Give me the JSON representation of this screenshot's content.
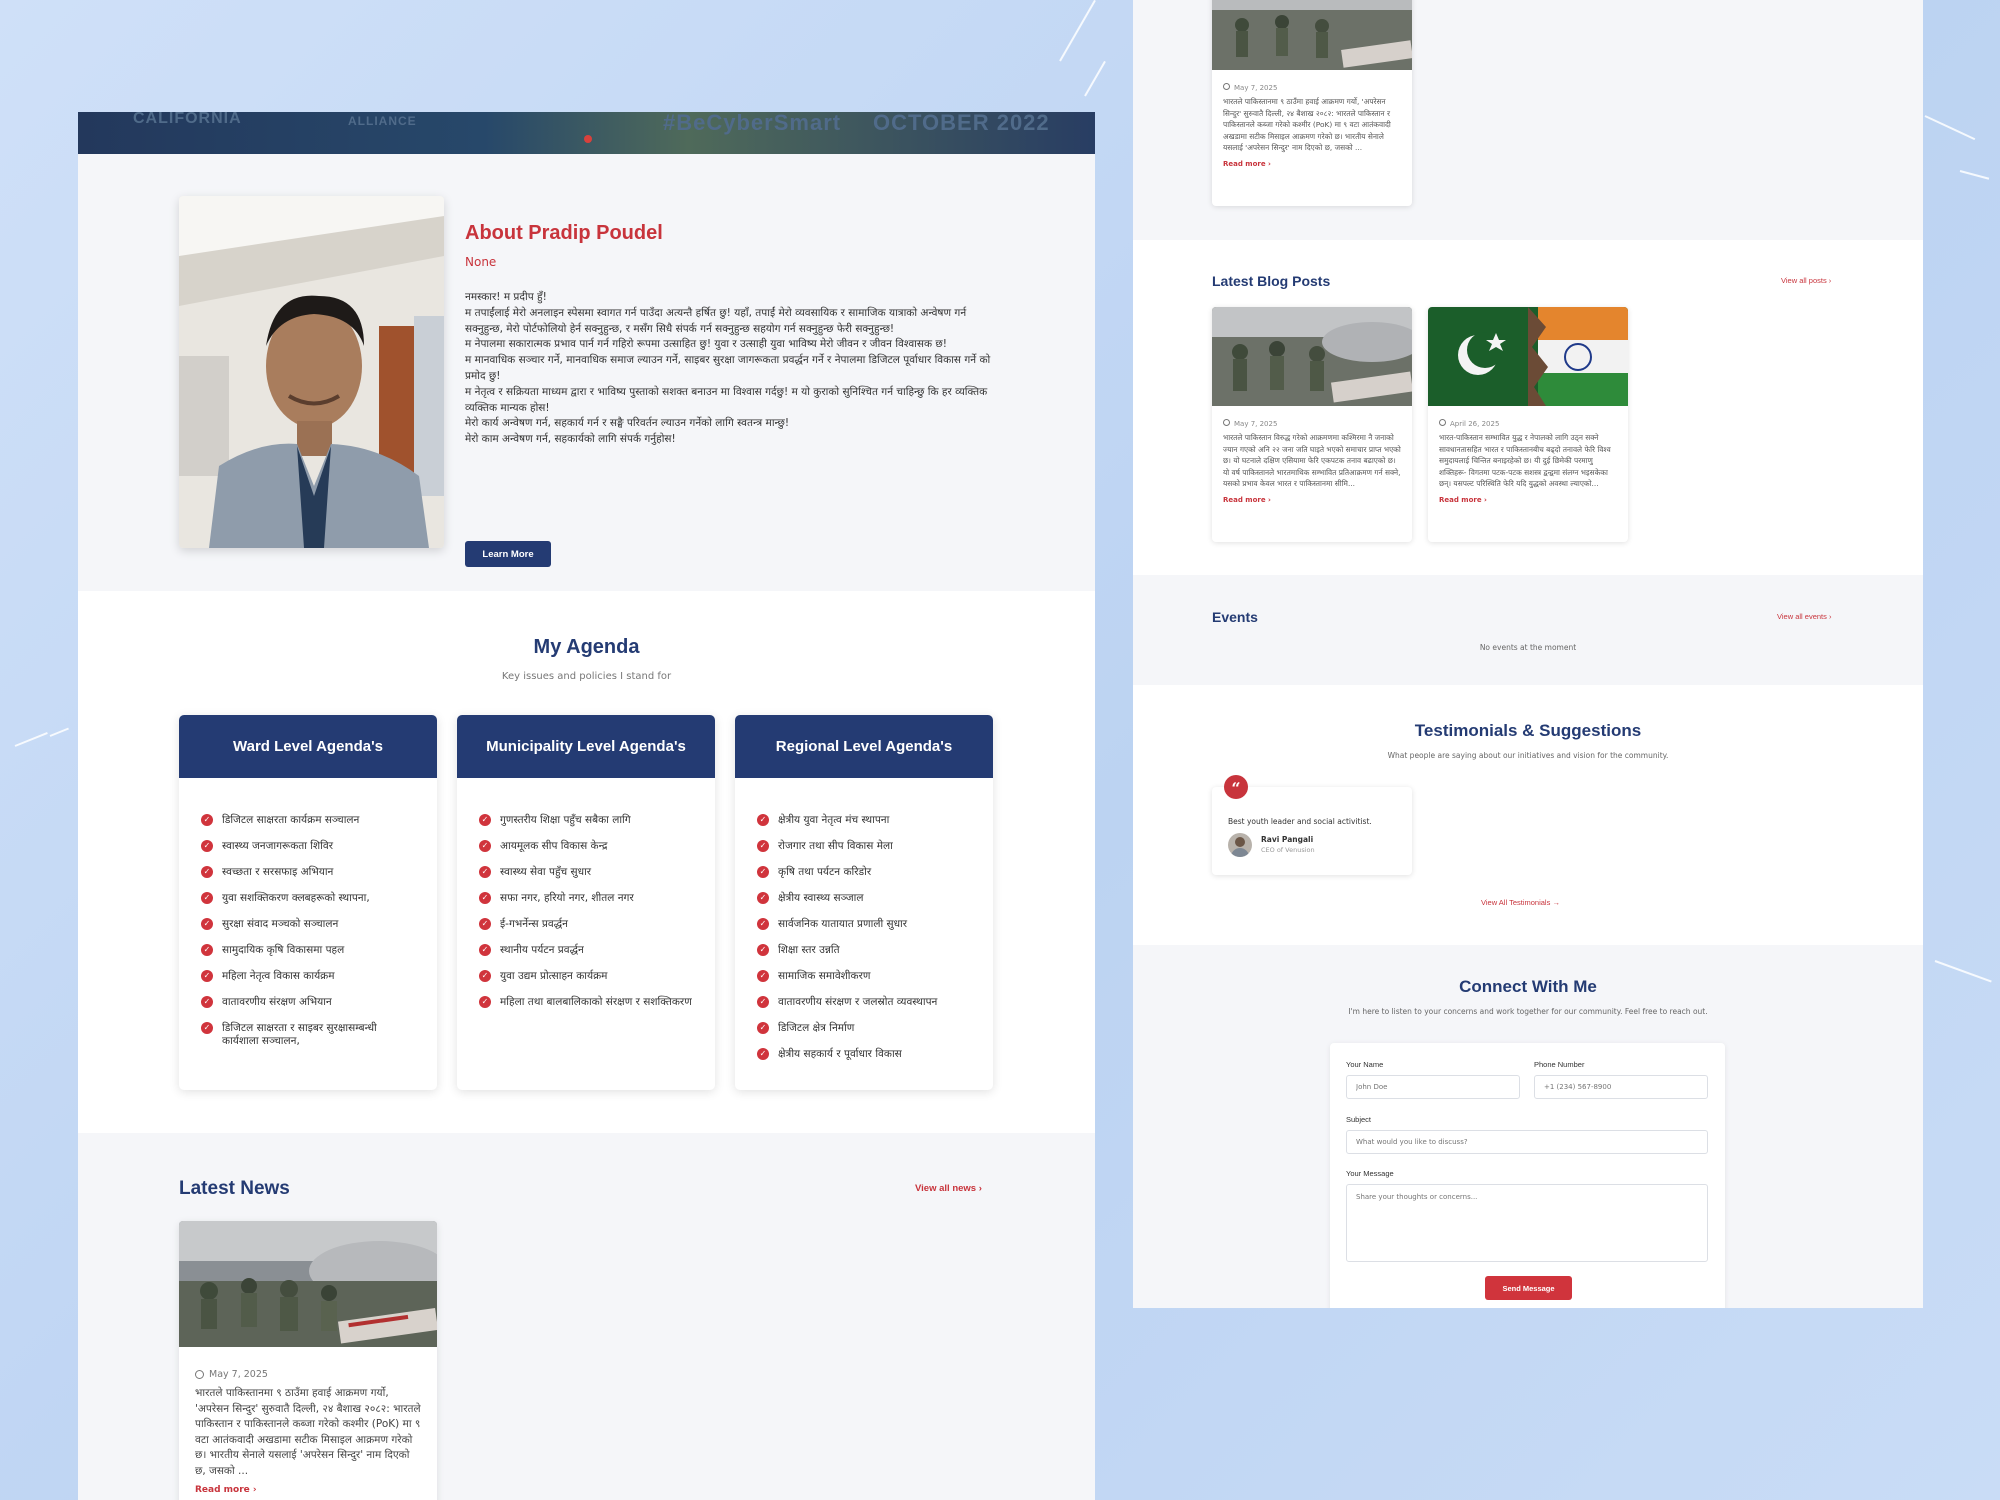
{
  "colors": {
    "primary": "#243b73",
    "accent": "#c8343c",
    "background": "#c5d9f4"
  },
  "hero": {
    "texts": [
      "CALIFORNIA",
      "ALLIANCE",
      "#BeCyberSmart",
      "OCTOBER 2022"
    ]
  },
  "about": {
    "title": "About Pradip Poudel",
    "subtitle": "None",
    "paragraphs": [
      "नमस्कार! म प्रदीप हुँ!",
      "म तपाईंलाई मेरो अनलाइन स्पेसमा स्वागत गर्न पाउँदा अत्यन्तै हर्षित छु! यहाँ, तपाईं मेरो व्यवसायिक र सामाजिक यात्राको अन्वेषण गर्न सक्नुहुन्छ, मेरो पोर्टफोलियो हेर्न सक्नुहुन्छ, र मसँग सिधै संपर्क गर्न सक्नुहुन्छ सहयोग गर्न सक्नुहुन्छ फेरी सक्नुहुन्छ!",
      "म नेपालमा सकारात्मक प्रभाव पार्न गर्न गहिरो रूपमा उत्साहित छु! युवा र उत्साही युवा भाविष्य मेरो जीवन र जीवन विश्वासक छ!",
      "म मानवाधिक सञ्चार गर्ने, मानवाधिक समाज ल्याउन गर्ने, साइबर सुरक्षा जागरूकता प्रवर्द्धन गर्ने र नेपालमा डिजिटल पूर्वाधार विकास गर्ने को प्रमोद छु!",
      "म नेतृत्व र सक्रियता माध्यम द्वारा र भाविष्य पुस्ताको सशक्त बनाउन मा विश्वास गर्दछु! म यो कुराको सुनिश्चित गर्न चाहिन्छु कि हर व्यक्तिक व्यक्तिक मान्यक होस!",
      "मेरो कार्य अन्वेषण गर्न, सहकार्य गर्न र सङ्घै परिवर्तन ल्याउन गर्नेको लागि स्वतन्त्र मान्छु!",
      "मेरो काम अन्वेषण गर्न, सहकार्यको लागि संपर्क गर्नुहोस!"
    ],
    "button_label": "Learn More"
  },
  "agenda": {
    "title": "My Agenda",
    "subtitle": "Key issues and policies I stand for",
    "cards": [
      {
        "title": "Ward Level Agenda's",
        "items": [
          "डिजिटल साक्षरता कार्यक्रम सञ्चालन",
          "स्वास्थ्य जनजागरूकता शिविर",
          "स्वच्छता र सरसफाइ अभियान",
          "युवा सशक्तिकरण क्लबहरूको स्थापना,",
          "सुरक्षा संवाद मञ्चको सञ्चालन",
          "सामुदायिक कृषि विकासमा पहल",
          "महिला नेतृत्व विकास कार्यक्रम",
          "वातावरणीय संरक्षण अभियान",
          "डिजिटल साक्षरता र साइबर सुरक्षासम्बन्धी कार्यशाला सञ्चालन,"
        ]
      },
      {
        "title": "Municipality Level Agenda's",
        "items": [
          "गुणस्तरीय शिक्षा पहुँच सबैका लागि",
          "आयमूलक सीप विकास केन्द्र",
          "स्वास्थ्य सेवा पहुँच सुधार",
          "सफा नगर, हरियो नगर, शीतल नगर",
          "ई-गभर्नेन्स प्रवर्द्धन",
          "स्थानीय पर्यटन प्रवर्द्धन",
          "युवा उद्यम प्रोत्साहन कार्यक्रम",
          "महिला तथा बालबालिकाको संरक्षण र सशक्तिकरण"
        ]
      },
      {
        "title": "Regional Level Agenda's",
        "items": [
          "क्षेत्रीय युवा नेतृत्व मंच स्थापना",
          "रोजगार तथा सीप विकास मेला",
          "कृषि तथा पर्यटन करिडोर",
          "क्षेत्रीय स्वास्थ्य सञ्जाल",
          "सार्वजनिक यातायात प्रणाली सुधार",
          "शिक्षा स्तर उन्नति",
          "सामाजिक समावेशीकरण",
          "वातावरणीय संरक्षण र जलस्रोत व्यवस्थापन",
          "डिजिटल क्षेत्र निर्माण",
          "क्षेत्रीय सहकार्य र पूर्वाधार विकास"
        ]
      }
    ]
  },
  "news": {
    "title": "Latest News",
    "view_all": "View all news",
    "card": {
      "date": "May 7, 2025",
      "excerpt": "भारतले पाकिस्तानमा ९ ठाउँमा हवाई आक्रमण गर्यो, 'अपरेसन सिन्दुर' सुरुवातै दिल्ली, २४ बैशाख २०८२: भारतले पाकिस्तान र पाकिस्तानले कब्जा गरेको कश्मीर (PoK) मा ९ वटा आतंकवादी अखडामा सटीक मिसाइल आक्रमण गरेको छ। भारतीय सेनाले यसलाई 'अपरेसन सिन्दुर' नाम दिएको छ, जसको ...",
      "read_more": "Read more"
    }
  },
  "right": {
    "top_card": {
      "date": "May 7, 2025",
      "excerpt": "भारतले पाकिस्तानमा ९ ठाउँमा हवाई आक्रमण गर्यो, 'अपरेसन सिन्दुर' सुरुवातै दिल्ली, २४ बैशाख २०८२: भारतले पाकिस्तान र पाकिस्तानले कब्जा गरेको कश्मीर (PoK) मा ९ वटा आतंकवादी अखडामा सटीक मिसाइल आक्रमण गरेको छ। भारतीय सेनाले यसलाई 'अपरेसन सिन्दुर' नाम दिएको छ, जसको ...",
      "read_more": "Read more"
    },
    "blog": {
      "title": "Latest Blog Posts",
      "view_all": "View all posts",
      "posts": [
        {
          "date": "May 7, 2025",
          "excerpt": "भारतले पाकिस्तान विरुद्ध गरेको आक्रमणमा कश्मिरमा नै जनाको ज्यान गएको अनि २२ जना जति घाइते भएको समाचार प्राप्त भएको छ। यो घटनाले दक्षिण एसियामा फेरि एकपटक तनाव बढाएको छ। यो वर्ष पाकिस्तानले भारतमाथिक सम्भावित प्रतिआक्रमण गर्न सक्ने, यसको प्रभाव केवल भारत र पाकिस्तानमा सीमि...",
          "read_more": "Read more"
        },
        {
          "date": "April 26, 2025",
          "excerpt": "भारत-पाकिस्तान सम्भावित युद्ध र नेपालको लागि उठ्न सक्ने सावधानतासहित भारत र पाकिस्तानबीच बढ्दो तनावले फेरि विश्व समुदायलाई चिन्तित बनाइरहेको छ। यी दुई छिमेकी परमाणु शक्तिहरू- विगतमा पटक-पटक सशस्त्र द्वन्द्वमा संलग्न भइसकेका छन्। यसपल्ट परिस्थिति फेरि यदि युद्धको अवस्था ल्याएको...",
          "read_more": "Read more"
        }
      ]
    },
    "events": {
      "title": "Events",
      "view_all": "View all events",
      "empty": "No events at the moment"
    },
    "testimonials": {
      "title": "Testimonials & Suggestions",
      "subtitle": "What people are saying about our initiatives and vision for the community.",
      "quote": "Best youth leader and social activitist.",
      "name": "Ravi Pangali",
      "role": "CEO of Venusion",
      "view_all": "View All Testimonials"
    },
    "connect": {
      "title": "Connect With Me",
      "subtitle": "I'm here to listen to your concerns and work together for our community. Feel free to reach out.",
      "name_label": "Your Name",
      "name_placeholder": "John Doe",
      "phone_label": "Phone Number",
      "phone_placeholder": "+1 (234) 567-8900",
      "subject_label": "Subject",
      "subject_placeholder": "What would you like to discuss?",
      "message_label": "Your Message",
      "message_placeholder": "Share your thoughts or concerns...",
      "send_label": "Send Message"
    }
  }
}
